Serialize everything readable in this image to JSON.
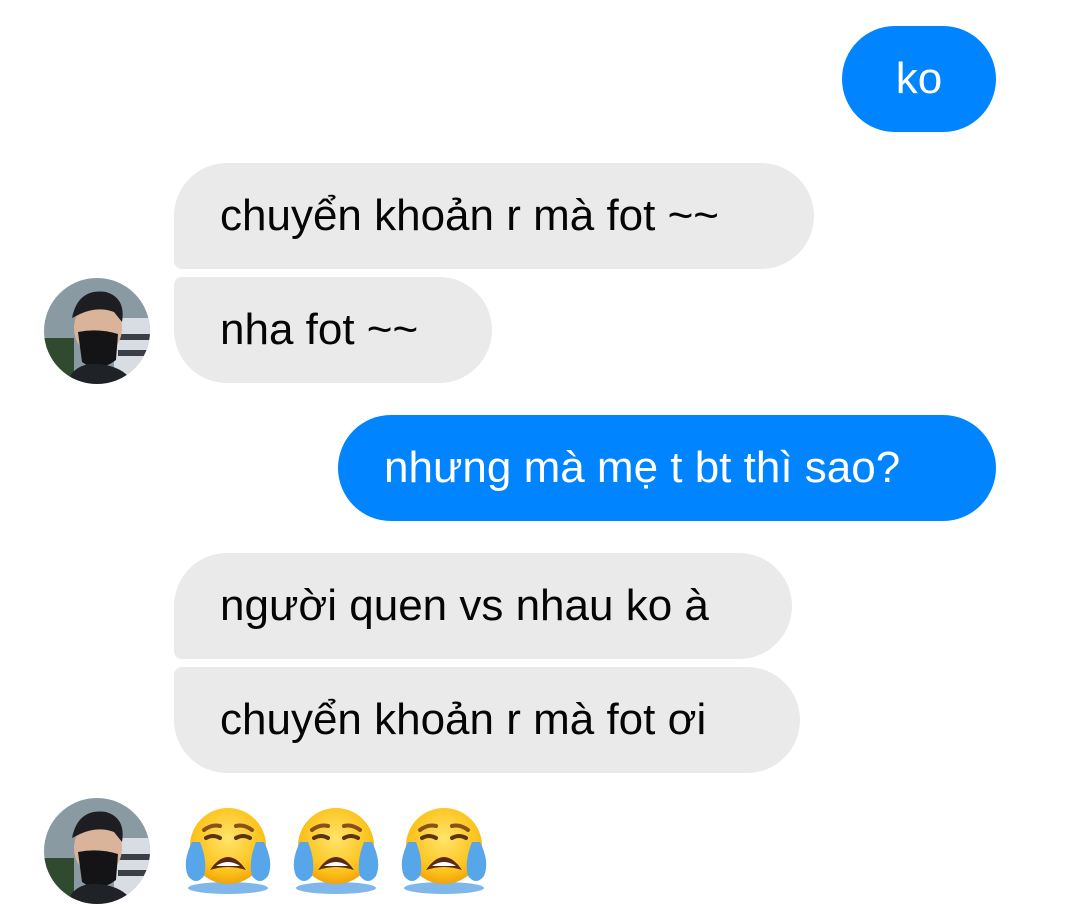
{
  "messages": [
    {
      "id": "m0",
      "direction": "outgoing",
      "text": "ko"
    },
    {
      "id": "m1",
      "direction": "incoming",
      "text": "chuyển khoản r mà fot ~~"
    },
    {
      "id": "m2",
      "direction": "incoming",
      "text": "nha fot ~~"
    },
    {
      "id": "m3",
      "direction": "outgoing",
      "text": "nhưng mà mẹ t bt thì sao?"
    },
    {
      "id": "m4",
      "direction": "incoming",
      "text": "người quen vs nhau ko à"
    },
    {
      "id": "m5",
      "direction": "incoming",
      "text": "chuyển khoản r mà fot ơi"
    }
  ],
  "emoji_message": {
    "icons": [
      "loudly-crying-face-icon",
      "loudly-crying-face-icon",
      "loudly-crying-face-icon"
    ]
  },
  "colors": {
    "outgoing_bubble": "#0084ff",
    "incoming_bubble": "#eaeaea",
    "background": "#ffffff"
  }
}
